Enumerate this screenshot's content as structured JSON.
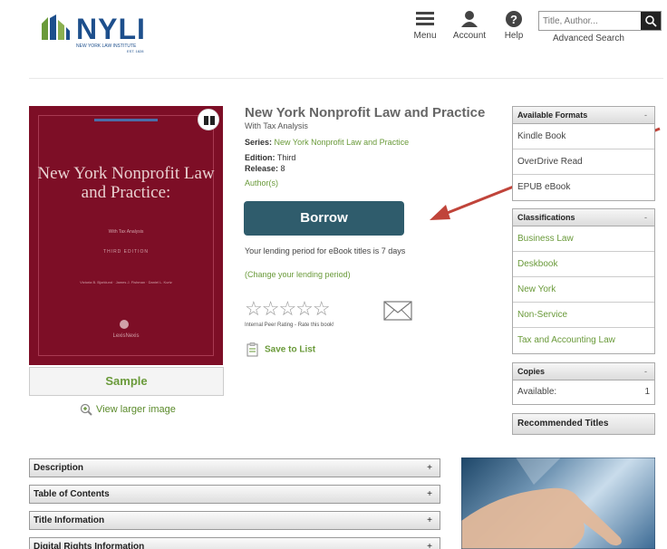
{
  "header": {
    "logo_text": "NYLI",
    "logo_sub": "NEW YORK LAW INSTITUTE",
    "logo_sub2": "EST. 1828",
    "nav": {
      "menu": "Menu",
      "account": "Account",
      "help": "Help"
    },
    "search_placeholder": "Title, Author...",
    "advanced_search": "Advanced Search"
  },
  "cover": {
    "title": "New York Nonprofit Law and Practice:",
    "subtitle": "With Tax Analysis",
    "edition": "THIRD EDITION",
    "authors": "Victoria B. Bjorklund · James J. Fishman · Daniel L. Kurtz",
    "publisher": "LexisNexis"
  },
  "sample_label": "Sample",
  "view_larger": "View larger image",
  "book": {
    "title": "New York Nonprofit Law and Practice",
    "subtitle": "With Tax Analysis",
    "series_label": "Series:",
    "series_value": "New York Nonprofit Law and Practice",
    "edition_label": "Edition:",
    "edition_value": "Third",
    "release_label": "Release:",
    "release_value": "8",
    "authors_link": "Author(s)"
  },
  "borrow_label": "Borrow",
  "lending_text": "Your lending period for eBook titles is 7 days",
  "change_lending": "(Change your lending period)",
  "rating": {
    "stars": "☆☆☆☆☆",
    "label": "Internal Peer Rating - Rate this book!",
    "value": 0
  },
  "save_to_list": "Save to List",
  "formats": {
    "header": "Available Formats",
    "items": [
      "Kindle Book",
      "OverDrive Read",
      "EPUB eBook"
    ]
  },
  "classifications": {
    "header": "Classifications",
    "items": [
      "Business Law",
      "Deskbook",
      "New York",
      "Non-Service",
      "Tax and Accounting Law"
    ]
  },
  "copies": {
    "header": "Copies",
    "available_label": "Available:",
    "available_value": "1"
  },
  "recommended": "Recommended Titles",
  "accordions": [
    {
      "label": "Description"
    },
    {
      "label": "Table of Contents"
    },
    {
      "label": "Title Information"
    },
    {
      "label": "Digital Rights Information"
    }
  ],
  "colors": {
    "accent_green": "#6a9a3a",
    "borrow_bg": "#2f5c6c",
    "cover_bg": "#7d0e26",
    "arrow": "#c0443a",
    "logo_blue": "#1d4f8c"
  }
}
